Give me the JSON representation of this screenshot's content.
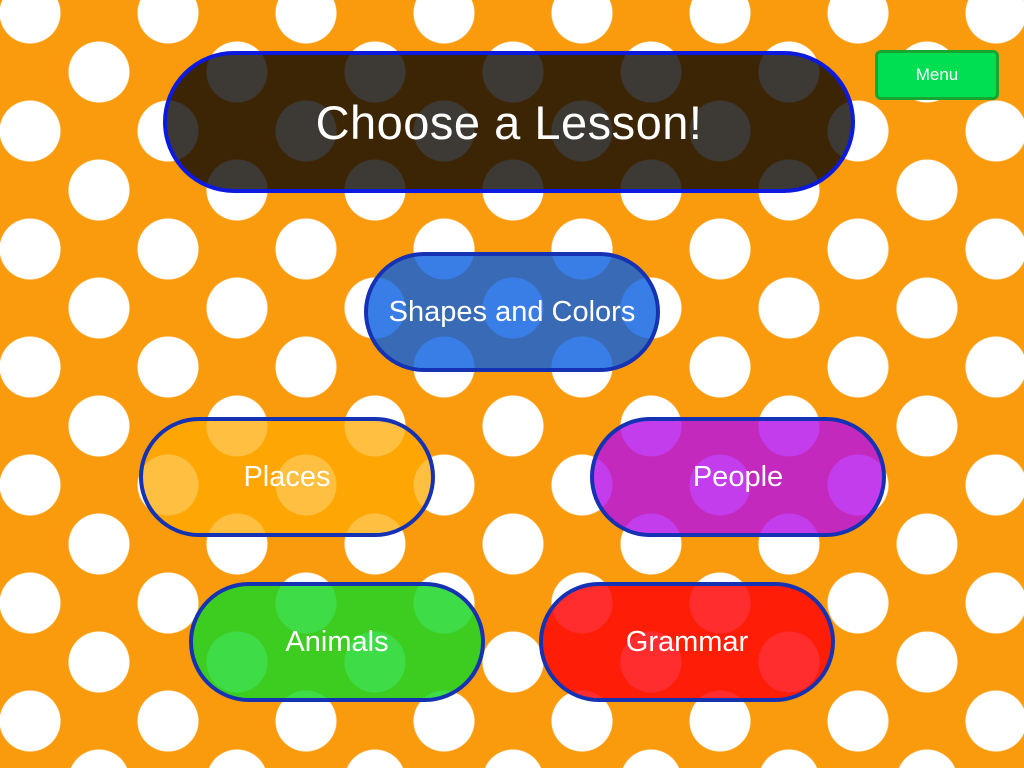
{
  "title": "Choose a Lesson!",
  "menu_label": "Menu",
  "lessons": [
    {
      "id": "shapes",
      "label": "Shapes and Colors",
      "color": "#2f7fe8"
    },
    {
      "id": "places",
      "label": "Places",
      "color": "#ffab00"
    },
    {
      "id": "people",
      "label": "People",
      "color": "#b820d4"
    },
    {
      "id": "animals",
      "label": "Animals",
      "color": "#2fd535"
    },
    {
      "id": "grammar",
      "label": "Grammar",
      "color": "#ff1a0a"
    }
  ],
  "colors": {
    "background": "#f99b0c",
    "dots": "#ffffff",
    "button_border": "#1532b5",
    "title_border": "#0c1adf",
    "menu_button": "#00de52"
  }
}
